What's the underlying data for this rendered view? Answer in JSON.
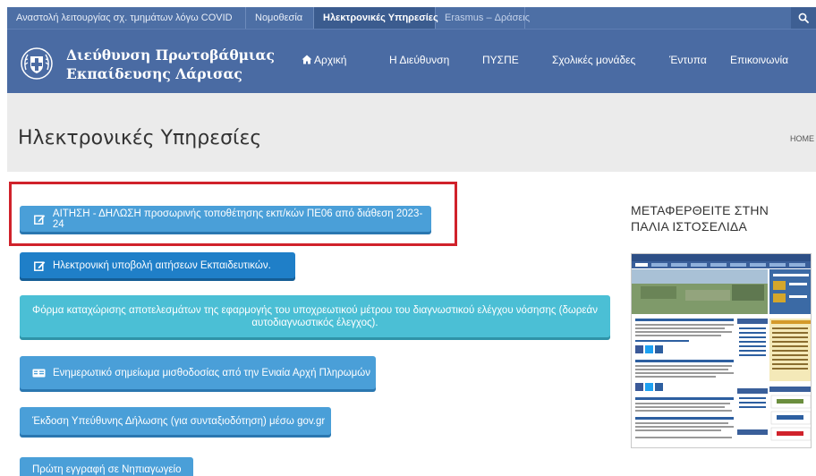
{
  "topbar": {
    "links": [
      {
        "label": "Αναστολή λειτουργίας σχ. τμημάτων λόγω COVID",
        "active": false
      },
      {
        "label": "Νομοθεσία",
        "active": false
      },
      {
        "label": "Ηλεκτρονικές Υπηρεσίες",
        "active": true
      },
      {
        "label": "Erasmus – Δράσεις",
        "active": false
      }
    ],
    "search_icon": "search-icon"
  },
  "header": {
    "site_name_line1": "Διεύθυνση Πρωτοβάθμιας",
    "site_name_line2": "Εκπαίδευσης Λάρισας",
    "nav": [
      {
        "label": "Αρχική",
        "icon": "home-icon"
      },
      {
        "label": "Η Διεύθυνση"
      },
      {
        "label": "ΠΥΣΠΕ"
      },
      {
        "label": "Σχολικές μονάδες"
      },
      {
        "label": "Έντυπα"
      },
      {
        "label": "Επικοινωνία"
      }
    ]
  },
  "page": {
    "title": "Ηλεκτρονικές Υπηρεσίες",
    "breadcrumb": "HOME"
  },
  "services": [
    {
      "label": "ΑΙΤΗΣΗ - ΔΗΛΩΣΗ προσωρινής τοποθέτησης εκπ/κών ΠΕ06 από διάθεση 2023-24",
      "icon": "edit-icon"
    },
    {
      "label": "Ηλεκτρονική υποβολή αιτήσεων Εκπαιδευτικών.",
      "icon": "edit-icon"
    },
    {
      "label_line1": "Φόρμα καταχώρισης αποτελεσμάτων της εφαρμογής του υποχρεωτικού μέτρου του διαγνωστικού ελέγχου νόσησης (δωρεάν",
      "label_line2": "αυτοδιαγνωστικός έλεγχος)."
    },
    {
      "label": "Ενημερωτικό σημείωμα μισθοδοσίας από την Ενιαία Αρχή Πληρωμών",
      "icon": "id-card-icon"
    },
    {
      "label": "Έκδοση Υπεύθυνης Δήλωσης (για συνταξιοδότηση) μέσω gov.gr"
    },
    {
      "label": "Πρώτη εγγραφή σε Νηπιαγωγείο"
    }
  ],
  "sidebar": {
    "heading_line1": "ΜΕΤΑΦΕΡΘΕΙΤΕ ΣΤΗΝ",
    "heading_line2": "ΠΑΛΙΑ ΙΣΤΟΣΕΛΙΔΑ"
  },
  "colors": {
    "topbar": "#4d6fa5",
    "header": "#4a6ba3",
    "button_blue": "#4a9fd8",
    "button_dark": "#1f7fc8",
    "button_teal": "#4bbfd5",
    "highlight": "#d0222b"
  }
}
